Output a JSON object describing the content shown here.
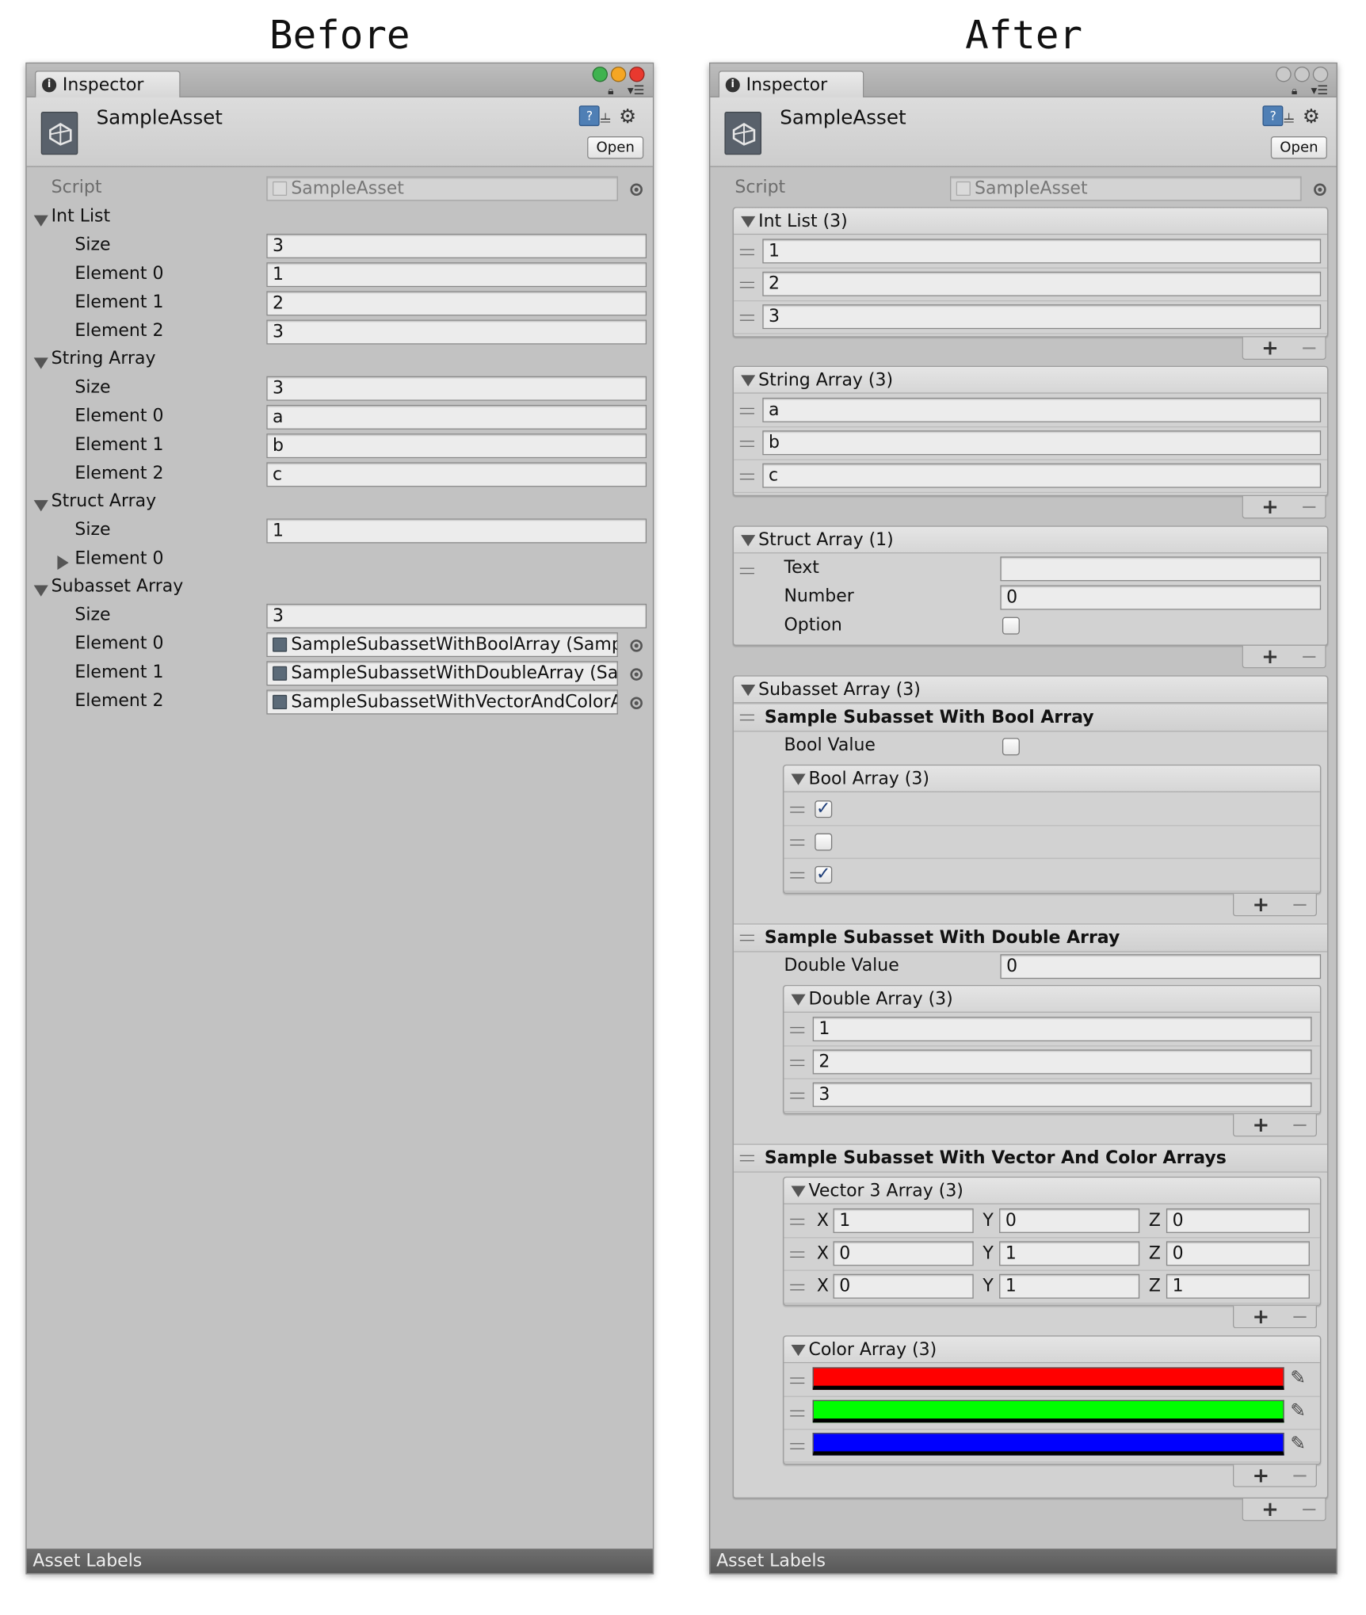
{
  "headings": {
    "before": "Before",
    "after": "After"
  },
  "window": {
    "tab_label": "Inspector",
    "asset_title": "SampleAsset",
    "open_button": "Open",
    "footer_label": "Asset Labels",
    "light_colors_before": [
      "#3fb34f",
      "#f5a623",
      "#e8392f"
    ],
    "light_colors_after": [
      "#c9c9c9",
      "#c9c9c9",
      "#c9c9c9"
    ]
  },
  "before": {
    "script_label": "Script",
    "script_value": "SampleAsset",
    "int_list": {
      "label": "Int List",
      "size_label": "Size",
      "size": "3",
      "elements": [
        {
          "label": "Element 0",
          "value": "1"
        },
        {
          "label": "Element 1",
          "value": "2"
        },
        {
          "label": "Element 2",
          "value": "3"
        }
      ]
    },
    "string_array": {
      "label": "String Array",
      "size_label": "Size",
      "size": "3",
      "elements": [
        {
          "label": "Element 0",
          "value": "a"
        },
        {
          "label": "Element 1",
          "value": "b"
        },
        {
          "label": "Element 2",
          "value": "c"
        }
      ]
    },
    "struct_array": {
      "label": "Struct Array",
      "size_label": "Size",
      "size": "1",
      "element_label": "Element 0"
    },
    "subasset_array": {
      "label": "Subasset Array",
      "size_label": "Size",
      "size": "3",
      "elements": [
        {
          "label": "Element 0",
          "value": "SampleSubassetWithBoolArray (Sample"
        },
        {
          "label": "Element 1",
          "value": "SampleSubassetWithDoubleArray (Sam"
        },
        {
          "label": "Element 2",
          "value": "SampleSubassetWithVectorAndColorAr"
        }
      ]
    }
  },
  "after": {
    "script_label": "Script",
    "script_value": "SampleAsset",
    "int_list": {
      "title": "Int List (3)",
      "items": [
        "1",
        "2",
        "3"
      ]
    },
    "string_array": {
      "title": "String Array (3)",
      "items": [
        "a",
        "b",
        "c"
      ]
    },
    "struct_array": {
      "title": "Struct Array (1)",
      "text_label": "Text",
      "text_value": "",
      "number_label": "Number",
      "number_value": "0",
      "option_label": "Option"
    },
    "subasset_array": {
      "title": "Subasset Array (3)",
      "bool_subasset": {
        "title": "Sample Subasset With Bool Array",
        "bool_value_label": "Bool Value",
        "bool_array": {
          "title": "Bool Array (3)",
          "items": [
            true,
            false,
            true
          ]
        }
      },
      "double_subasset": {
        "title": "Sample Subasset With Double Array",
        "double_value_label": "Double Value",
        "double_value": "0",
        "double_array": {
          "title": "Double Array (3)",
          "items": [
            "1",
            "2",
            "3"
          ]
        }
      },
      "vector_color_subasset": {
        "title": "Sample Subasset With Vector And Color Arrays",
        "vector_array": {
          "title": "Vector 3 Array (3)",
          "axis_labels": [
            "X",
            "Y",
            "Z"
          ],
          "items": [
            {
              "x": "1",
              "y": "0",
              "z": "0"
            },
            {
              "x": "0",
              "y": "1",
              "z": "0"
            },
            {
              "x": "0",
              "y": "1",
              "z": "1"
            }
          ]
        },
        "color_array": {
          "title": "Color Array (3)",
          "items": [
            "#ff0000",
            "#00ff00",
            "#0000ff"
          ]
        }
      }
    }
  },
  "icons": [
    "info-icon",
    "lock-icon",
    "menu-icon",
    "unity-logo-icon",
    "help-icon",
    "presets-icon",
    "gear-icon",
    "object-picker-icon",
    "drag-handle-icon",
    "foldout-arrow-icon",
    "add-icon",
    "remove-icon",
    "eyedropper-icon",
    "checkmark-icon"
  ]
}
